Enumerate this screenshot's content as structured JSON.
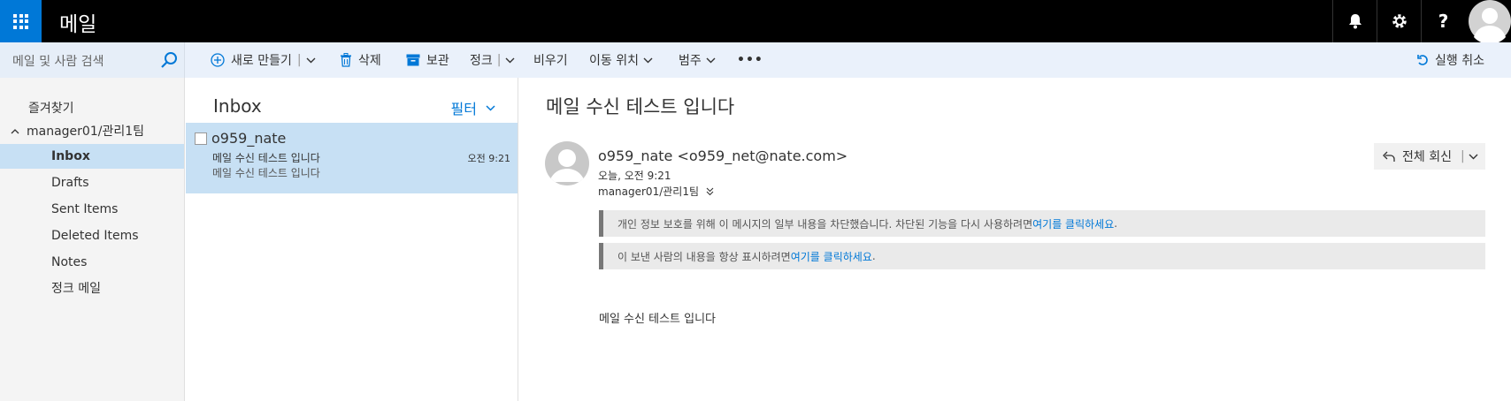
{
  "app": {
    "title": "메일"
  },
  "search": {
    "placeholder": "메일 및 사람 검색"
  },
  "toolbar": {
    "new_label": "새로 만들기",
    "delete_label": "삭제",
    "archive_label": "보관",
    "junk_label": "정크",
    "empty_label": "비우기",
    "move_label": "이동 위치",
    "category_label": "범주",
    "more_label": "•••",
    "undo_label": "실행 취소"
  },
  "nav": {
    "favorites": "즐겨찾기",
    "account": "manager01/관리1팀",
    "folders": [
      "Inbox",
      "Drafts",
      "Sent Items",
      "Deleted Items",
      "Notes",
      "정크 메일"
    ]
  },
  "list": {
    "title": "Inbox",
    "filter_label": "필터",
    "message": {
      "sender": "o959_nate",
      "subject": "메일 수신 테스트 입니다",
      "time": "오전 9:21",
      "preview": "메일 수신 테스트 입니다"
    }
  },
  "reading": {
    "subject": "메일 수신 테스트 입니다",
    "from": "o959_nate <o959_net@nate.com>",
    "date": "오늘, 오전 9:21",
    "to": "manager01/관리1팀",
    "reply_all_label": "전체 회신",
    "banner1_text": "개인 정보 보호를 위해 이 메시지의 일부 내용을 차단했습니다. 차단된 기능을 다시 사용하려면 ",
    "banner1_link": "여기를 클릭하세요",
    "banner2_text": "이 보낸 사람의 내용을 항상 표시하려면 ",
    "banner2_link": "여기를 클릭하세요",
    "body": "메일 수신 테스트 입니다"
  },
  "colors": {
    "accent": "#0078d7",
    "selected": "#c7e0f4",
    "topbar": "#000000",
    "cmdbar": "#eaf1fb"
  },
  "icons": [
    "waffle-icon",
    "bell-icon",
    "gear-icon",
    "help-icon",
    "user-avatar-icon",
    "search-icon",
    "plus-circle-icon",
    "trash-icon",
    "archive-icon",
    "undo-icon",
    "reply-all-icon",
    "chevron-down-icon"
  ]
}
